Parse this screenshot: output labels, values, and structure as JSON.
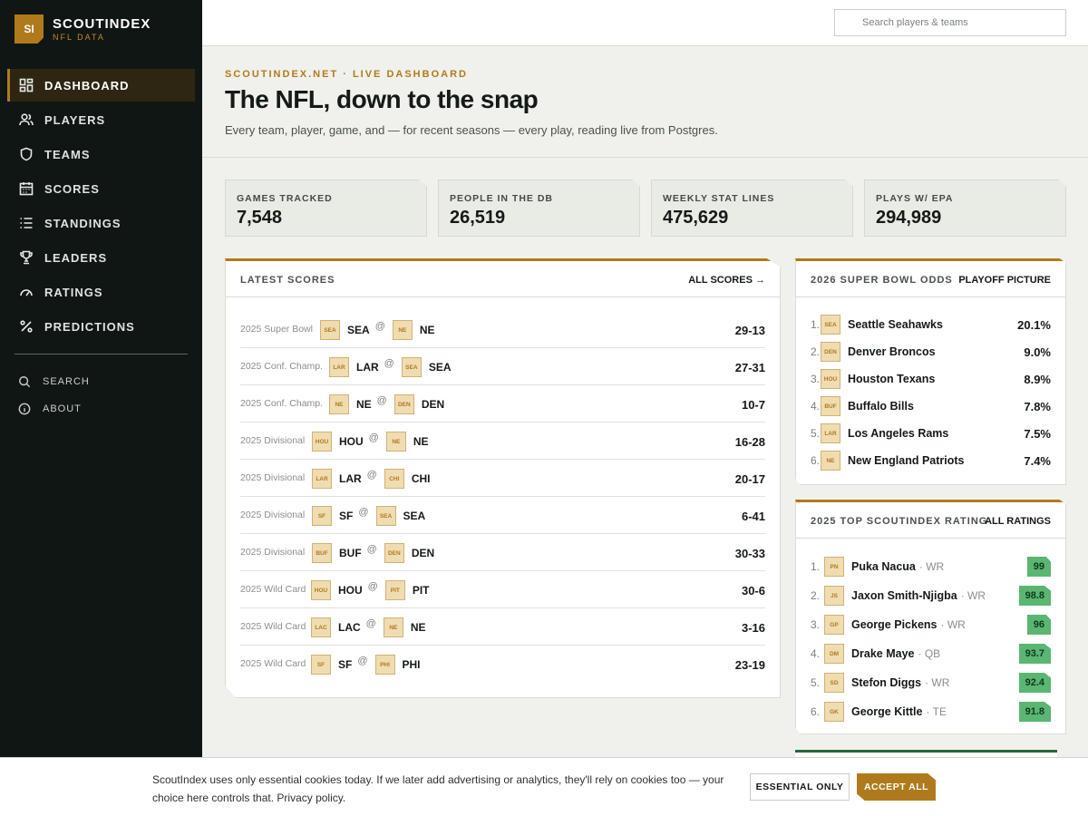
{
  "brand": {
    "logo": "SI",
    "name": "SCOUTINDEX",
    "sub": "NFL DATA"
  },
  "nav": [
    {
      "label": "DASHBOARD",
      "icon": "dashboard-icon",
      "active": true
    },
    {
      "label": "PLAYERS",
      "icon": "users-icon"
    },
    {
      "label": "TEAMS",
      "icon": "shield-icon"
    },
    {
      "label": "SCORES",
      "icon": "calendar-icon"
    },
    {
      "label": "STANDINGS",
      "icon": "list-icon"
    },
    {
      "label": "LEADERS",
      "icon": "trophy-icon"
    },
    {
      "label": "RATINGS",
      "icon": "gauge-icon"
    },
    {
      "label": "PREDICTIONS",
      "icon": "percent-icon"
    }
  ],
  "subnav": [
    {
      "label": "SEARCH",
      "icon": "search-icon"
    },
    {
      "label": "ABOUT",
      "icon": "info-icon"
    }
  ],
  "search": {
    "placeholder": "Search players & teams"
  },
  "hero": {
    "eyebrow": "SCOUTINDEX.NET · LIVE DASHBOARD",
    "title": "The NFL, down to the snap",
    "subtitle": "Every team, player, game, and — for recent seasons — every play, reading live from Postgres."
  },
  "stats": [
    {
      "label": "GAMES TRACKED",
      "value": "7,548"
    },
    {
      "label": "PEOPLE IN THE DB",
      "value": "26,519"
    },
    {
      "label": "WEEKLY STAT LINES",
      "value": "475,629"
    },
    {
      "label": "PLAYS W/ EPA",
      "value": "294,989"
    }
  ],
  "scores": {
    "title": "LATEST SCORES",
    "link": "ALL SCORES →",
    "games": [
      {
        "round": "2025 Super Bowl",
        "away": "SEA",
        "home": "NE",
        "score": "29-13"
      },
      {
        "round": "2025 Conf. Champ.",
        "away": "LAR",
        "home": "SEA",
        "score": "27-31"
      },
      {
        "round": "2025 Conf. Champ.",
        "away": "NE",
        "home": "DEN",
        "score": "10-7"
      },
      {
        "round": "2025 Divisional",
        "away": "HOU",
        "home": "NE",
        "score": "16-28"
      },
      {
        "round": "2025 Divisional",
        "away": "LAR",
        "home": "CHI",
        "score": "20-17"
      },
      {
        "round": "2025 Divisional",
        "away": "SF",
        "home": "SEA",
        "score": "6-41"
      },
      {
        "round": "2025 Divisional",
        "away": "BUF",
        "home": "DEN",
        "score": "30-33"
      },
      {
        "round": "2025 Wild Card",
        "away": "HOU",
        "home": "PIT",
        "score": "30-6"
      },
      {
        "round": "2025 Wild Card",
        "away": "LAC",
        "home": "NE",
        "score": "3-16"
      },
      {
        "round": "2025 Wild Card",
        "away": "SF",
        "home": "PHI",
        "score": "23-19"
      }
    ]
  },
  "odds": {
    "title": "2026 SUPER BOWL ODDS",
    "link": "PLAYOFF PICTURE",
    "teams": [
      {
        "rank": "1.",
        "badge": "SEA",
        "name": "Seattle Seahawks",
        "odds": "20.1%"
      },
      {
        "rank": "2.",
        "badge": "DEN",
        "name": "Denver Broncos",
        "odds": "9.0%"
      },
      {
        "rank": "3.",
        "badge": "HOU",
        "name": "Houston Texans",
        "odds": "8.9%"
      },
      {
        "rank": "4.",
        "badge": "BUF",
        "name": "Buffalo Bills",
        "odds": "7.8%"
      },
      {
        "rank": "5.",
        "badge": "LAR",
        "name": "Los Angeles Rams",
        "odds": "7.5%"
      },
      {
        "rank": "6.",
        "badge": "NE",
        "name": "New England Patriots",
        "odds": "7.4%"
      }
    ]
  },
  "ratings": {
    "title": "2025 TOP SCOUTINDEX RATING",
    "link": "ALL RATINGS",
    "players": [
      {
        "rank": "1.",
        "badge": "PN",
        "name": "Puka Nacua",
        "pos": "· WR",
        "rating": "99"
      },
      {
        "rank": "2.",
        "badge": "JS",
        "name": "Jaxon Smith-Njigba",
        "pos": "· WR",
        "rating": "98.8"
      },
      {
        "rank": "3.",
        "badge": "GP",
        "name": "George Pickens",
        "pos": "· WR",
        "rating": "96"
      },
      {
        "rank": "4.",
        "badge": "DM",
        "name": "Drake Maye",
        "pos": "· QB",
        "rating": "93.7"
      },
      {
        "rank": "5.",
        "badge": "SD",
        "name": "Stefon Diggs",
        "pos": "· WR",
        "rating": "92.4"
      },
      {
        "rank": "6.",
        "badge": "GK",
        "name": "George Kittle",
        "pos": "· TE",
        "rating": "91.8"
      }
    ]
  },
  "cookie": {
    "text": "ScoutIndex uses only essential cookies today. If we later add advertising or analytics, they'll rely on cookies too — your choice here controls that. Privacy policy.",
    "essential": "ESSENTIAL ONLY",
    "accept": "ACCEPT ALL"
  },
  "colors": {
    "accent": "#b07a1c",
    "sidebar": "#101614",
    "rating": "#5bb573"
  }
}
